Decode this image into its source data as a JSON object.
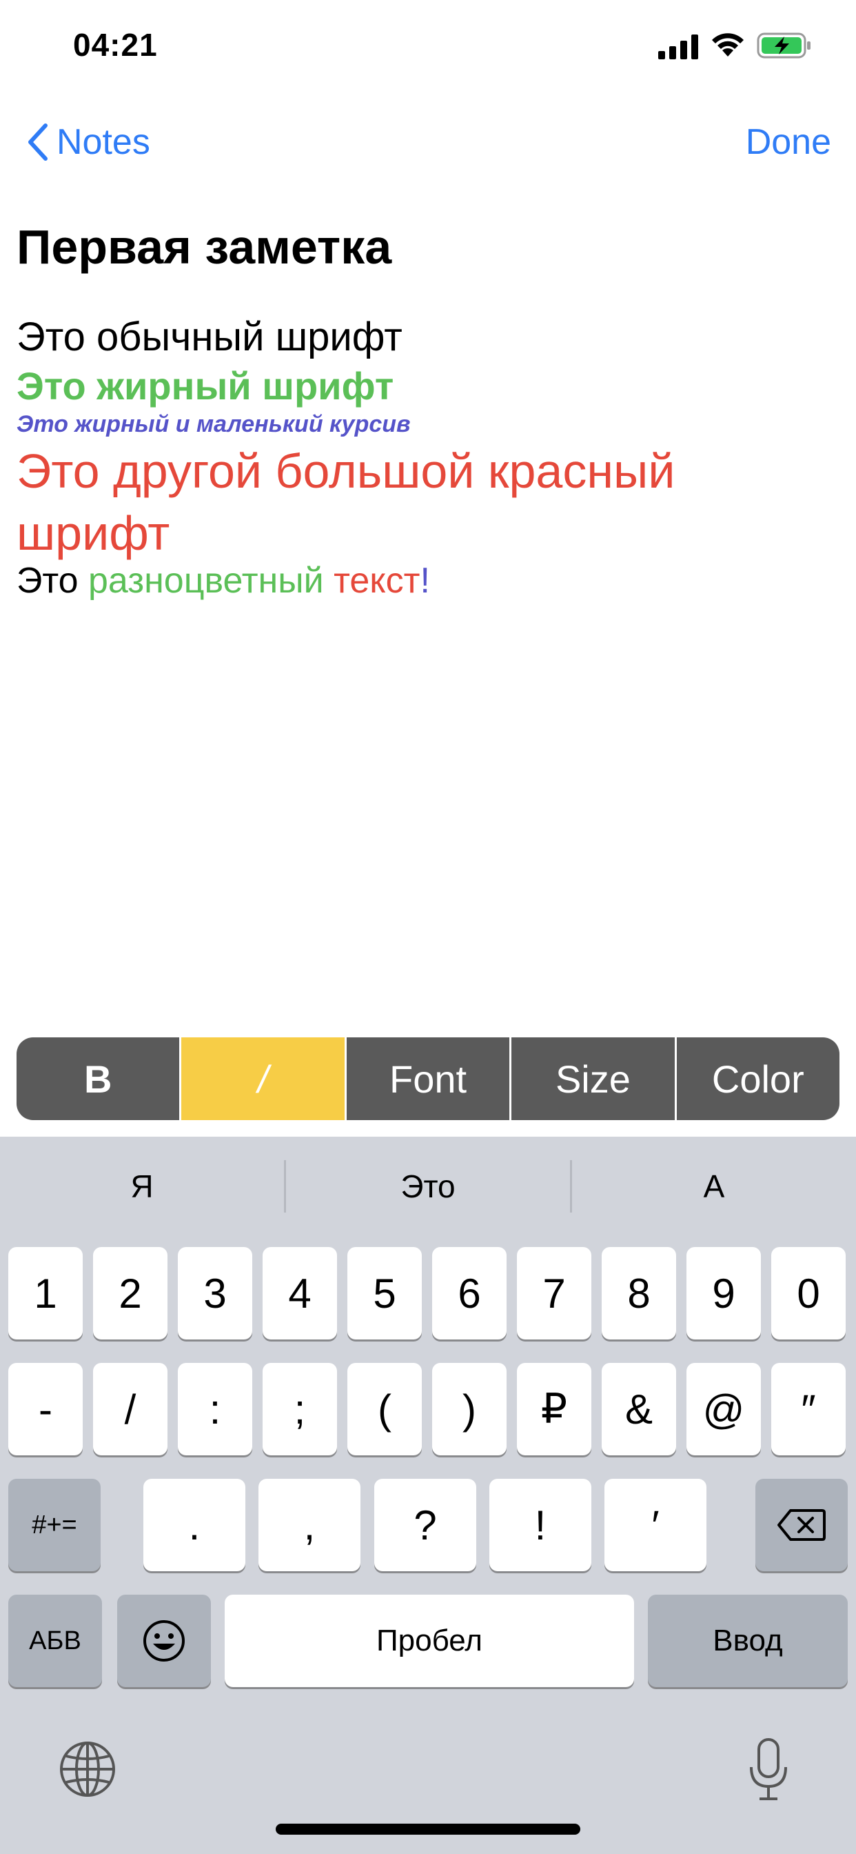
{
  "status_bar": {
    "time": "04:21"
  },
  "nav": {
    "back_label": "Notes",
    "done_label": "Done"
  },
  "note": {
    "title": "Первая заметка",
    "line_regular": "Это обычный шрифт",
    "line_bold": "Это жирный шрифт",
    "line_bold_small_italic": "Это жирный и маленький курсив",
    "line_big_red": "Это другой большой красный шрифт",
    "line_multicolor": {
      "part1": "Это ",
      "part2": "разноцветный",
      "part3": " ",
      "part4": "текст",
      "part5": "!"
    }
  },
  "format_toolbar": {
    "bold": "B",
    "italic": "/",
    "font": "Font",
    "size": "Size",
    "color": "Color",
    "active": "italic"
  },
  "keyboard": {
    "predictions": [
      "Я",
      "Это",
      "А"
    ],
    "row1": [
      "1",
      "2",
      "3",
      "4",
      "5",
      "6",
      "7",
      "8",
      "9",
      "0"
    ],
    "row2": [
      "-",
      "/",
      ":",
      ";",
      "(",
      ")",
      "₽",
      "&",
      "@",
      "″"
    ],
    "row3": [
      ".",
      ",",
      "?",
      "!",
      "′"
    ],
    "symbols_key": "#+=",
    "layout_key": "АБВ",
    "space_key": "Пробел",
    "return_key": "Ввод"
  },
  "colors": {
    "accent": "#2f7cf6",
    "green": "#5bbf57",
    "red": "#e5483a",
    "purple": "#5553c9",
    "toolbar": "#5a5a5a",
    "toolbar_active": "#f7cd46",
    "keyboard_bg": "#d1d4db"
  },
  "icons": [
    "cellular-signal-icon",
    "wifi-icon",
    "battery-charging-icon",
    "chevron-left-icon",
    "emoji-icon",
    "delete-icon",
    "globe-icon",
    "microphone-icon"
  ]
}
